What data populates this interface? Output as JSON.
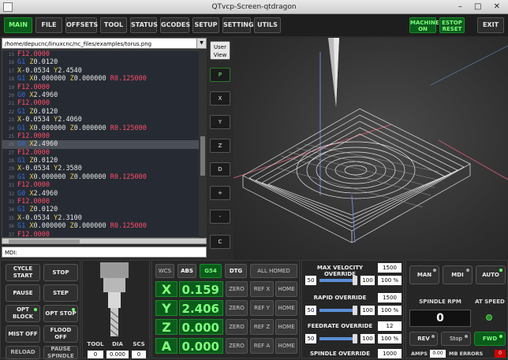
{
  "window": {
    "title": "QTvcp-Screen-qtdragon",
    "controls": "– □ ✕"
  },
  "tabs": [
    {
      "label": "MAIN",
      "active": true
    },
    {
      "label": "FILE"
    },
    {
      "label": "OFFSETS"
    },
    {
      "label": "TOOL"
    },
    {
      "label": "STATUS"
    },
    {
      "label": "GCODES"
    },
    {
      "label": "SETUP"
    },
    {
      "label": "SETTINGS"
    },
    {
      "label": "UTILS"
    }
  ],
  "header_right": {
    "machine_on": "MACHINE ON",
    "estop_reset": "ESTOP RESET",
    "exit": "EXIT"
  },
  "file_path": "/home/depucnc/linuxcnc/nc_files/examples/torus.png",
  "gcode_lines": [
    {
      "n": "15",
      "text": "F12.0000",
      "cur": false
    },
    {
      "n": "16",
      "text": "G1 Z0.0120",
      "cur": false
    },
    {
      "n": "17",
      "text": "X-0.0534 Y2.4540",
      "cur": false
    },
    {
      "n": "18",
      "text": "G1 X0.000000 Z0.000000 R0.125000",
      "cur": false
    },
    {
      "n": "19",
      "text": "F12.0000",
      "cur": false
    },
    {
      "n": "20",
      "text": "G0 X2.4960",
      "cur": false
    },
    {
      "n": "21",
      "text": "F12.0000",
      "cur": false
    },
    {
      "n": "22",
      "text": "G1 Z0.0120",
      "cur": false
    },
    {
      "n": "23",
      "text": "X-0.0534 Y2.4060",
      "cur": false
    },
    {
      "n": "24",
      "text": "G1 X0.000000 Z0.000000 R0.125000",
      "cur": false
    },
    {
      "n": "25",
      "text": "F12.0000",
      "cur": false
    },
    {
      "n": "26",
      "text": "G0 X2.4960",
      "cur": true
    },
    {
      "n": "27",
      "text": "F12.0000",
      "cur": false
    },
    {
      "n": "28",
      "text": "G1 Z0.0120",
      "cur": false
    },
    {
      "n": "29",
      "text": "X-0.0534 Y2.3580",
      "cur": false
    },
    {
      "n": "30",
      "text": "G1 X0.000000 Z0.000000 R0.125000",
      "cur": false
    },
    {
      "n": "31",
      "text": "F12.0000",
      "cur": false
    },
    {
      "n": "32",
      "text": "G0 X2.4960",
      "cur": false
    },
    {
      "n": "33",
      "text": "F12.0000",
      "cur": false
    },
    {
      "n": "34",
      "text": "G1 Z0.0120",
      "cur": false
    },
    {
      "n": "35",
      "text": "X-0.0534 Y2.3100",
      "cur": false
    },
    {
      "n": "36",
      "text": "G1 X0.000000 Z0.000000 R0.125000",
      "cur": false
    },
    {
      "n": "37",
      "text": "F12.0000",
      "cur": false
    },
    {
      "n": "38",
      "text": "G0 X0.1800",
      "cur": false
    }
  ],
  "mdi_label": "MDI:",
  "view_buttons": [
    "User View",
    "P",
    "X",
    "Y",
    "Z",
    "D",
    "+",
    "-",
    "C"
  ],
  "left_controls": {
    "cycle_start": "CYCLE START",
    "stop": "STOP",
    "pause": "PAUSE",
    "step": "STEP",
    "opt_block": "OPT BLOCK",
    "opt_stop": "OPT STOP",
    "mist_off": "MIST OFF",
    "flood_off": "FLOOD OFF",
    "reload": "RELOAD",
    "pause_spindle": "PAUSE SPINDLE"
  },
  "tool_info": {
    "tool_label": "TOOL",
    "dia_label": "DIA",
    "scs_label": "SCS",
    "tool": "0",
    "dia": "0.000",
    "scs": "0"
  },
  "dro": {
    "wcs": "WCS",
    "abs": "ABS",
    "g54": "G54",
    "dtg": "DTG",
    "all_homed": "ALL HOMED",
    "axes": [
      {
        "name": "X",
        "value": "0.159",
        "ref": "REF X"
      },
      {
        "name": "Y",
        "value": "2.406",
        "ref": "REF Y"
      },
      {
        "name": "Z",
        "value": "0.000",
        "ref": "REF Z"
      },
      {
        "name": "A",
        "value": "0.000",
        "ref": "REF A"
      }
    ],
    "zero_label": "ZERO",
    "home_label": "HOME"
  },
  "overrides": {
    "max_velocity": {
      "label": "MAX VELOCITY OVERRIDE",
      "value": "1500",
      "min": "50",
      "max": "100",
      "pct": "100 %",
      "level": 1.0
    },
    "rapid": {
      "label": "RAPID OVERRIDE",
      "value": "1500",
      "min": "50",
      "max": "100",
      "pct": "100 %",
      "level": 1.0
    },
    "feedrate": {
      "label": "FEEDRATE OVERRIDE",
      "value": "12",
      "min": "50",
      "max": "100",
      "pct": "100 %",
      "level": 1.0
    },
    "spindle": {
      "label": "SPINDLE OVERRIDE",
      "value": "1000"
    }
  },
  "spindle_panel": {
    "man": "MAN",
    "mdi": "MDI",
    "auto": "AUTO",
    "rpm_label": "SPINDLE RPM",
    "at_speed_label": "AT SPEED",
    "rpm": "0",
    "rev": "REV",
    "stop": "Stop",
    "fwd": "FWD",
    "amps_label": "AMPS",
    "amps": "0.00",
    "mb_errors_label": "MB ERRORS",
    "mb_errors": "0"
  },
  "colors": {
    "accent_green": "#7dff7d",
    "dro_bg": "#0b5c1b",
    "feed_red": "#ff4d6a",
    "axis_yellow": "#e8d24a",
    "gcode_blue": "#3a6bd8"
  }
}
